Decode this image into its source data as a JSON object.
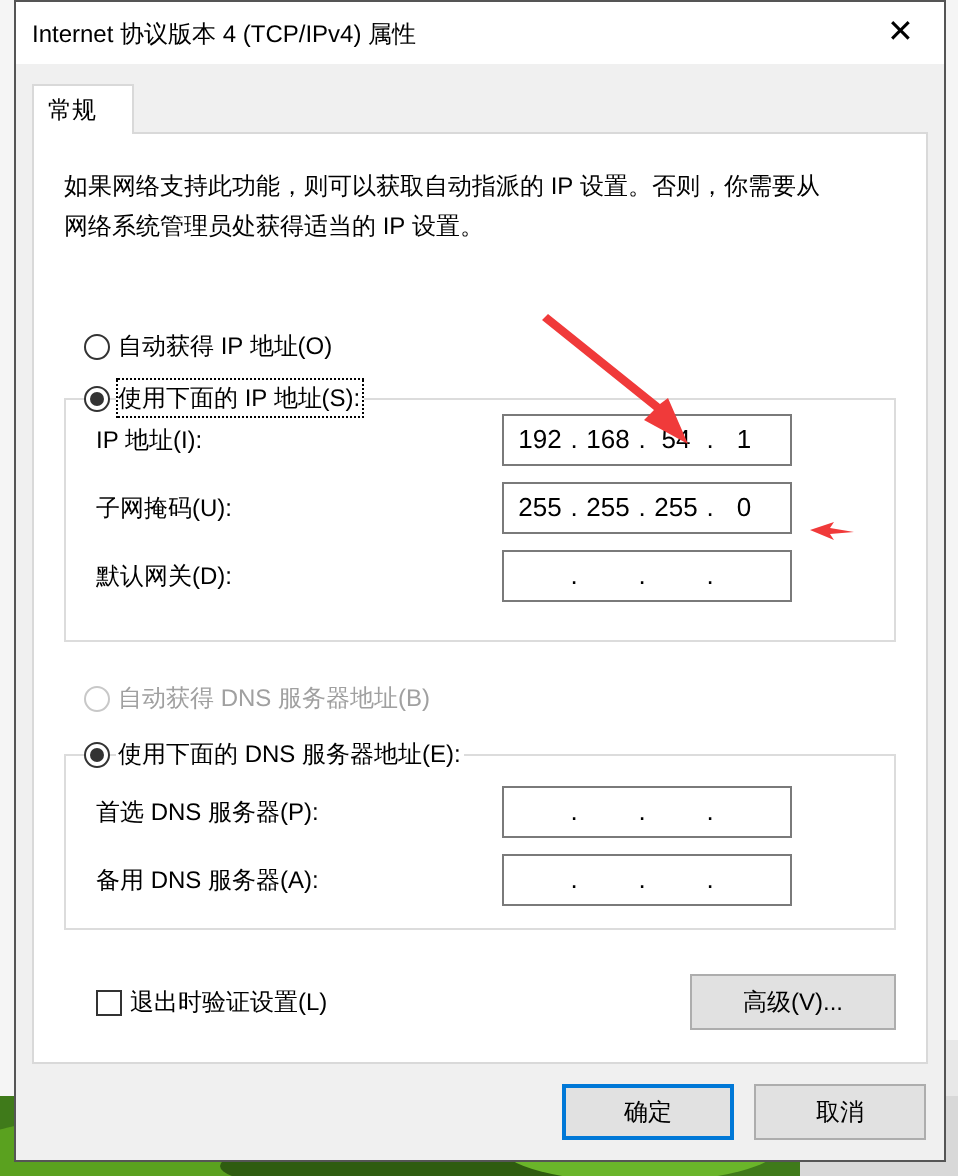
{
  "window": {
    "title": "Internet 协议版本 4 (TCP/IPv4) 属性",
    "close": "✕"
  },
  "tabs": [
    {
      "label": "常规",
      "selected": true
    }
  ],
  "description": "如果网络支持此功能，则可以获取自动指派的 IP 设置。否则，你需要从网络系统管理员处获得适当的 IP 设置。",
  "ip_mode": [
    {
      "label": "自动获得 IP 地址(O)",
      "selected": false,
      "disabled": false
    },
    {
      "label": "使用下面的 IP 地址(S):",
      "selected": true,
      "disabled": false
    }
  ],
  "ip_fields": [
    {
      "label": "IP 地址(I):",
      "octets": [
        "192",
        "168",
        "54",
        "1"
      ],
      "dots": [
        ".",
        ".",
        "."
      ]
    },
    {
      "label": "子网掩码(U):",
      "octets": [
        "255",
        "255",
        "255",
        "0"
      ],
      "dots": [
        ".",
        ".",
        "."
      ]
    },
    {
      "label": "默认网关(D):",
      "dots": [
        ".",
        ".",
        "."
      ]
    }
  ],
  "dns_mode": [
    {
      "label": "自动获得 DNS 服务器地址(B)",
      "selected": false,
      "disabled": true
    },
    {
      "label": "使用下面的 DNS 服务器地址(E):",
      "selected": true,
      "disabled": false
    }
  ],
  "dns_fields": [
    {
      "label": "首选 DNS 服务器(P):",
      "dots": [
        ".",
        ".",
        "."
      ]
    },
    {
      "label": "备用 DNS 服务器(A):",
      "dots": [
        ".",
        ".",
        "."
      ]
    }
  ],
  "validate": {
    "label": "退出时验证设置(L)",
    "checked": false
  },
  "advanced_button": "高级(V)...",
  "buttons": [
    {
      "label": "确定",
      "kind": "default"
    },
    {
      "label": "取消",
      "kind": "normal"
    }
  ]
}
